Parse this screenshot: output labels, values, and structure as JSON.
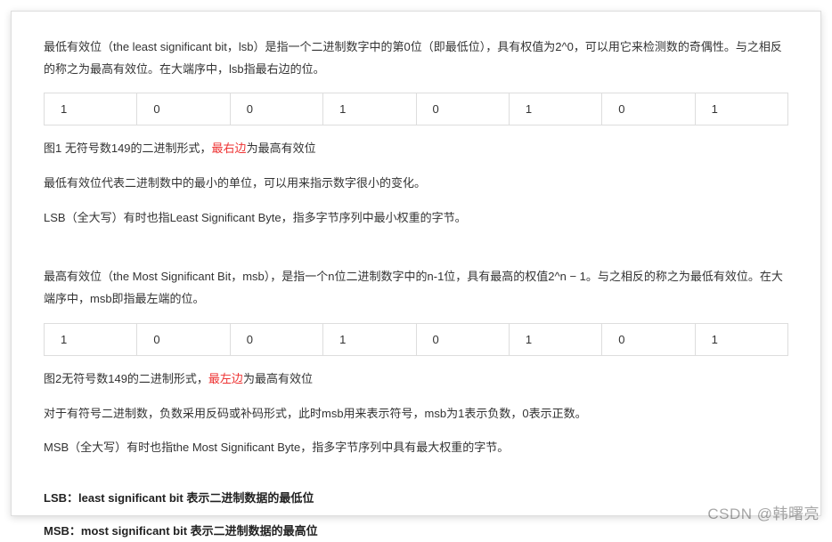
{
  "para_lsb_intro": "最低有效位（the least significant bit，lsb）是指一个二进制数字中的第0位（即最低位），具有权值为2^0，可以用它来检测数的奇偶性。与之相反的称之为最高有效位。在大端序中，lsb指最右边的位。",
  "table1": [
    "1",
    "0",
    "0",
    "1",
    "0",
    "1",
    "0",
    "1"
  ],
  "fig1_prefix": "图1 无符号数149的二进制形式，",
  "fig1_red": "最右边",
  "fig1_suffix": "为最高有效位",
  "para_lsb_unit": "最低有效位代表二进制数中的最小的单位，可以用来指示数字很小的变化。",
  "para_lsb_byte": "LSB（全大写）有时也指Least Significant Byte，指多字节序列中最小权重的字节。",
  "para_msb_intro": "最高有效位（the Most Significant Bit，msb），是指一个n位二进制数字中的n-1位，具有最高的权值2^n − 1。与之相反的称之为最低有效位。在大端序中，msb即指最左端的位。",
  "table2": [
    "1",
    "0",
    "0",
    "1",
    "0",
    "1",
    "0",
    "1"
  ],
  "fig2_prefix": "图2无符号数149的二进制形式，",
  "fig2_red": "最左边",
  "fig2_suffix": "为最高有效位",
  "para_signed": "对于有符号二进制数，负数采用反码或补码形式，此时msb用来表示符号，msb为1表示负数，0表示正数。",
  "para_msb_byte": "MSB（全大写）有时也指the Most Significant Byte，指多字节序列中具有最大权重的字节。",
  "bold_lsb": "LSB：least significant bit 表示二进制数据的最低位",
  "bold_msb": "MSB：most significant bit 表示二进制数据的最高位",
  "watermark": "CSDN @韩曙亮"
}
